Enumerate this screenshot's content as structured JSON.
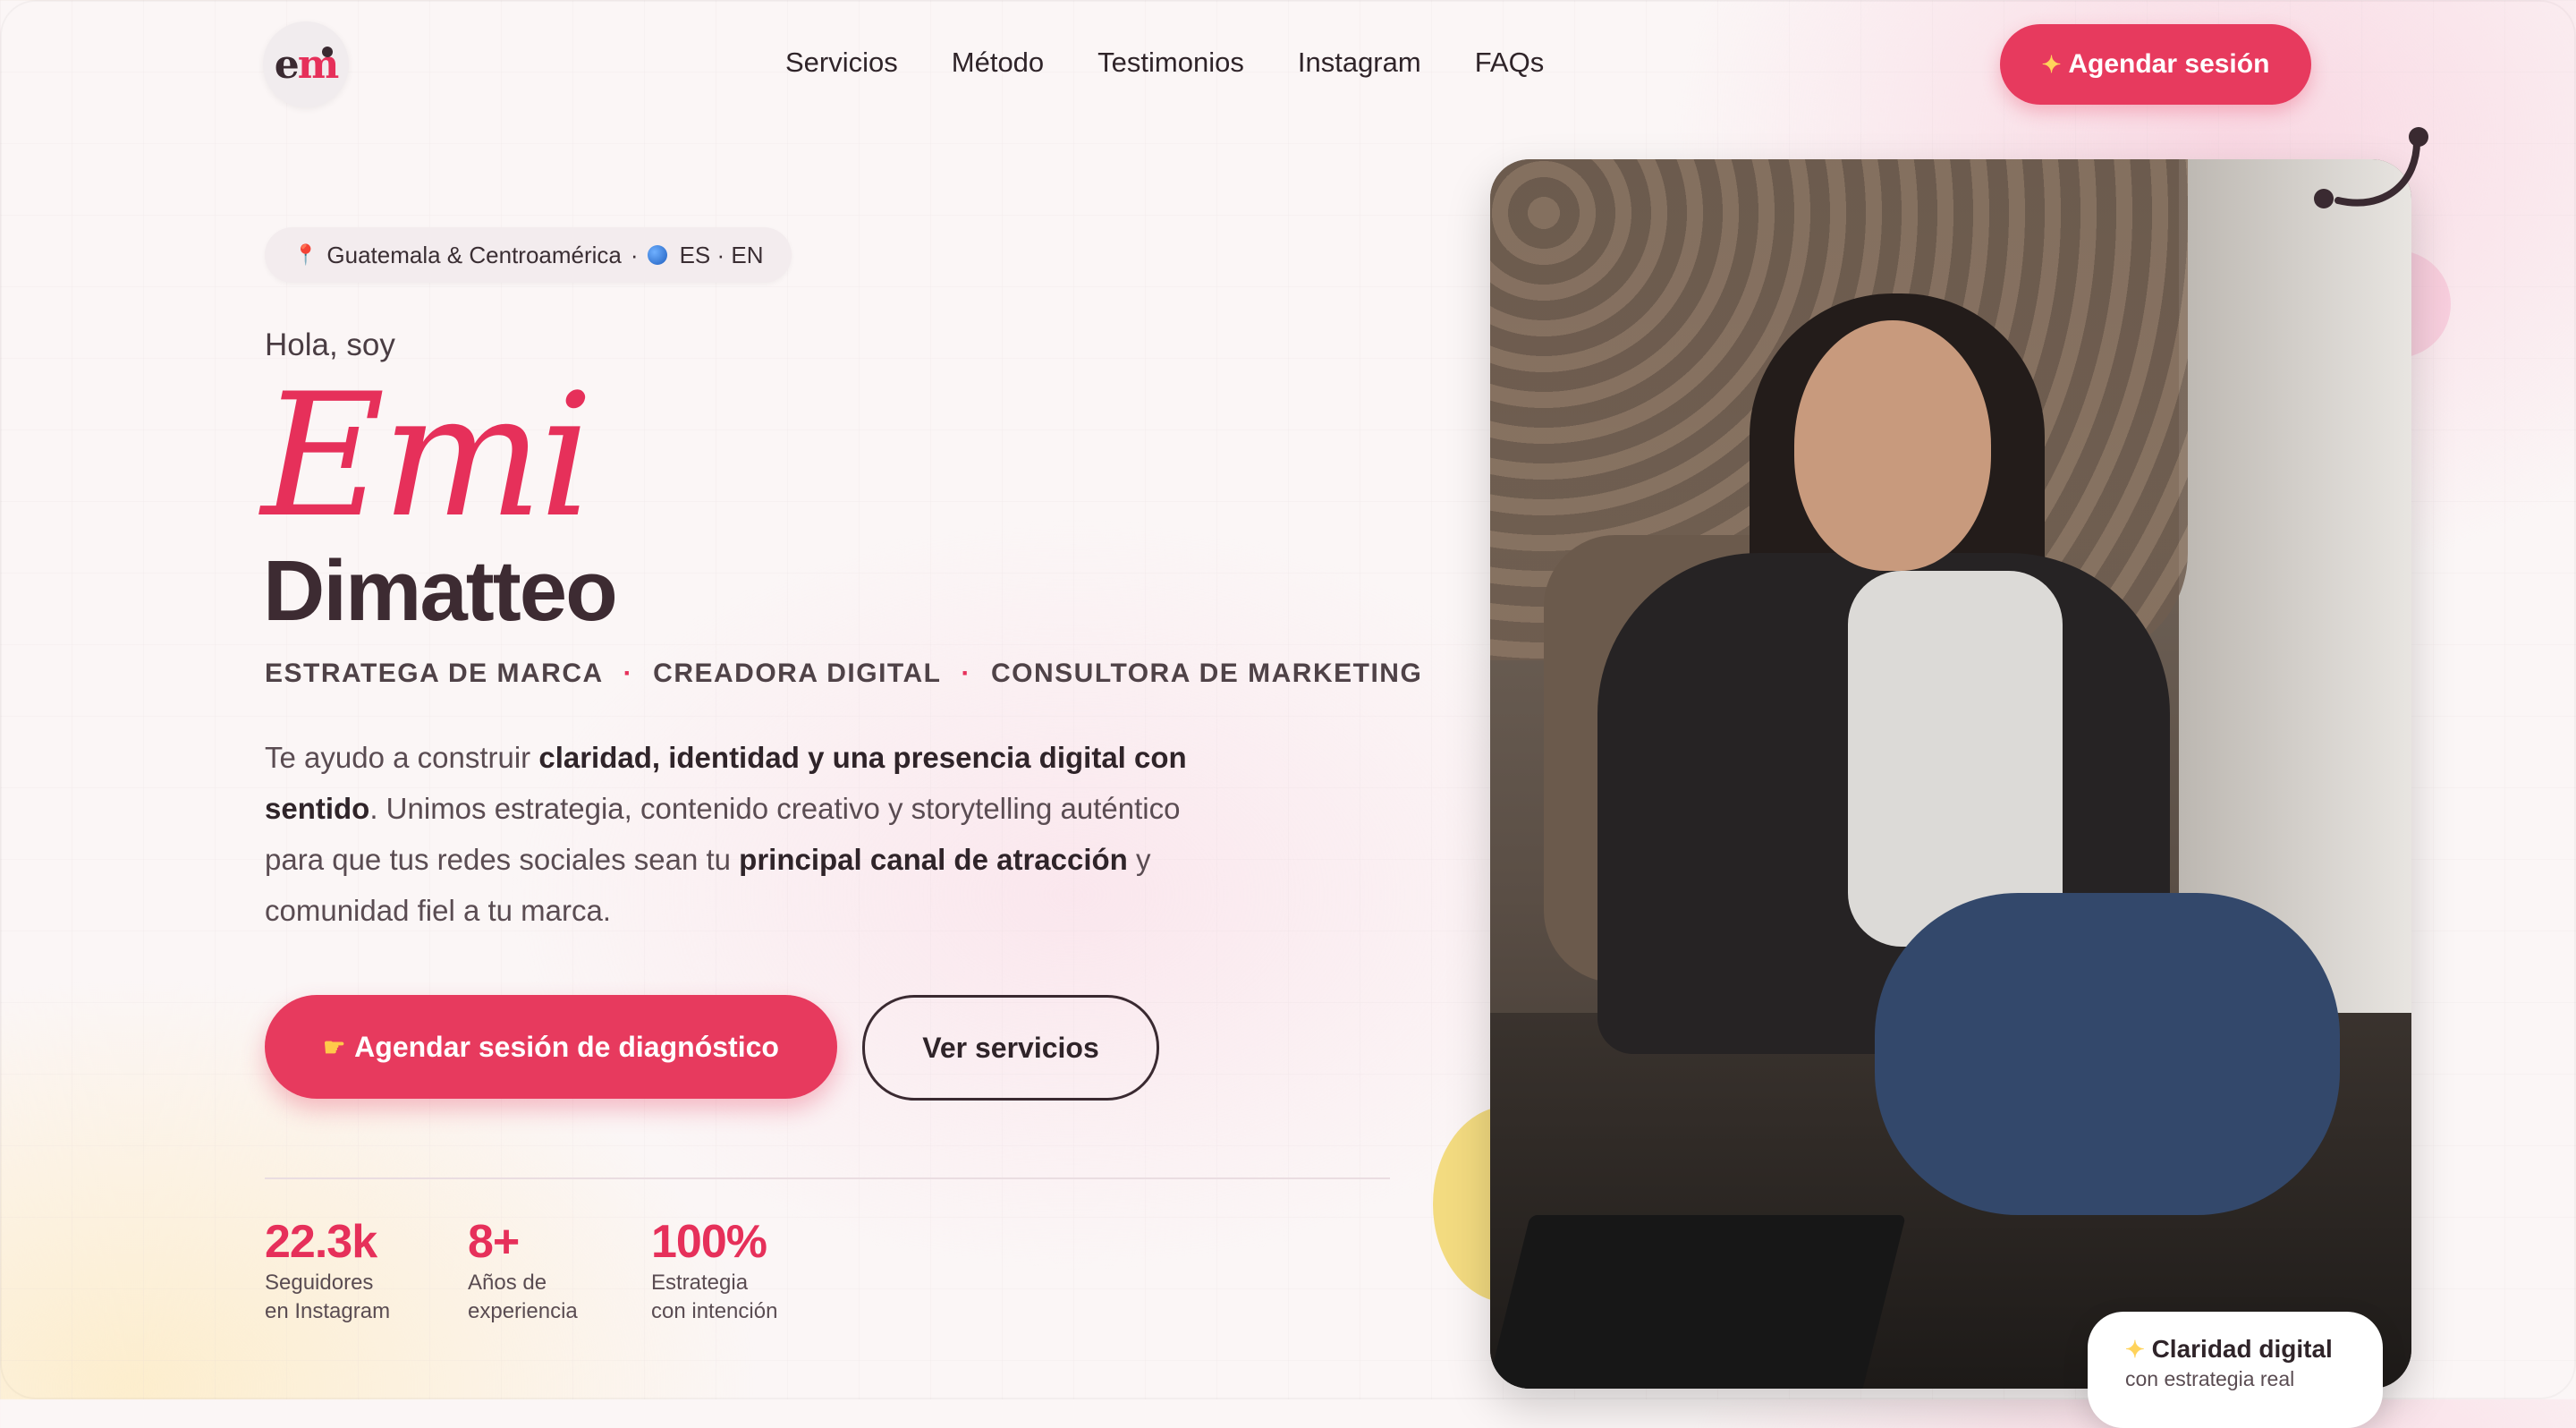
{
  "header": {
    "logo_text_a": "e",
    "logo_text_b": "m",
    "nav": [
      "Servicios",
      "Método",
      "Testimonios",
      "Instagram",
      "FAQs"
    ],
    "cta_icon": "sparkles-icon",
    "cta_label": "Agendar sesión"
  },
  "hero": {
    "location_chip": {
      "pin_icon": "map-pin-icon",
      "location": "Guatemala & Centroamérica",
      "separator": "·",
      "globe_icon": "globe-icon",
      "languages": "ES · EN"
    },
    "greeting": "Hola, soy",
    "first_name": "Emi",
    "last_name": "Dimatteo",
    "roles": [
      "ESTRATEGA DE MARCA",
      "CREADORA DIGITAL",
      "CONSULTORA DE MARKETING"
    ],
    "role_separator": "·",
    "description": {
      "p1": "Te ayudo a construir ",
      "b1": "claridad, identidad y una presencia digital con sentido",
      "p2": ". Unimos estrategia, contenido creativo y storytelling auténtico para que tus redes sociales sean tu ",
      "b2": "principal canal de atracción",
      "p3": " y comunidad fiel a tu marca."
    },
    "primary_button": {
      "icon": "pointing-hand-icon",
      "label": "Agendar sesión de diagnóstico"
    },
    "secondary_button": {
      "label": "Ver servicios"
    },
    "stats": [
      {
        "value": "22.3k",
        "label_line1": "Seguidores",
        "label_line2": "en Instagram"
      },
      {
        "value": "8+",
        "label_line1": "Años de",
        "label_line2": "experiencia"
      },
      {
        "value": "100%",
        "label_line1": "Estrategia",
        "label_line2": "con intención"
      }
    ]
  },
  "photo_badge": {
    "icon": "sparkles-icon",
    "title": "Claridad digital",
    "subtitle": "con estrategia real"
  },
  "colors": {
    "accent": "#e73a5e",
    "dark": "#3d2b32",
    "background": "#fbf6f6",
    "yellow": "#f2d873"
  }
}
